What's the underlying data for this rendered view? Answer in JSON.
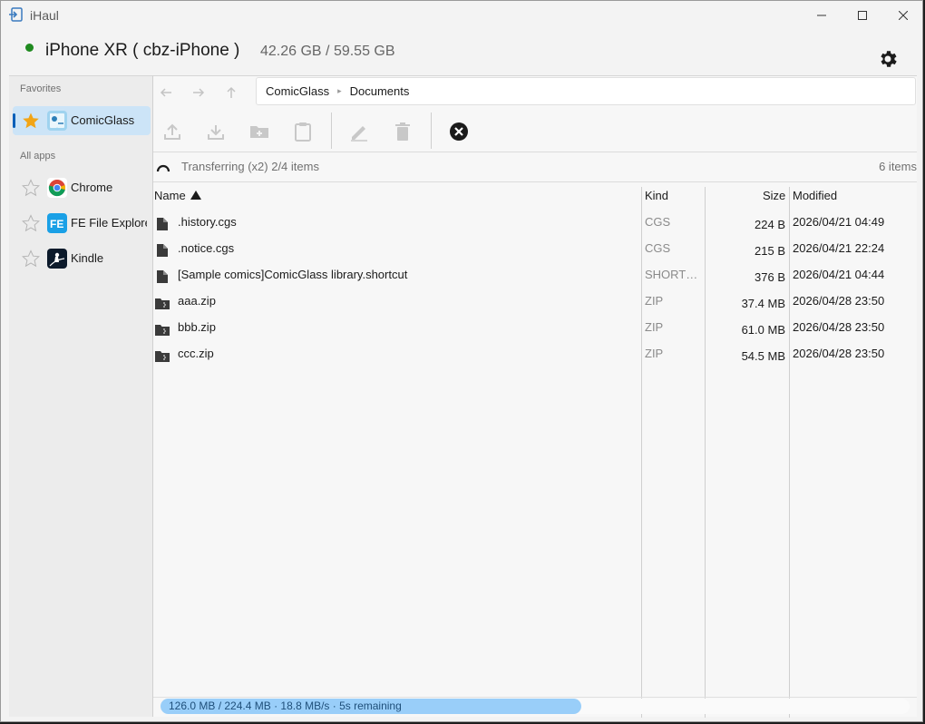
{
  "window": {
    "title": "iHaul"
  },
  "device": {
    "name": "iPhone XR ( cbz-iPhone )",
    "capacity": "42.26 GB / 59.55 GB",
    "status_color": "#1f8a1f"
  },
  "sidebar": {
    "favorites_header": "Favorites",
    "favorites": [
      {
        "label": "ComicGlass",
        "icon": "comicglass-app-icon",
        "starred": true,
        "selected": true
      }
    ],
    "all_apps_header": "All apps",
    "apps": [
      {
        "label": "Chrome",
        "icon": "chrome-app-icon",
        "starred": false
      },
      {
        "label": "FE File Explorer",
        "icon": "fe-file-explorer-app-icon",
        "starred": false
      },
      {
        "label": "Kindle",
        "icon": "kindle-app-icon",
        "starred": false
      }
    ]
  },
  "breadcrumb": [
    "ComicGlass",
    "Documents"
  ],
  "toolbar": {
    "buttons": [
      "upload-icon",
      "download-icon",
      "new-folder-icon",
      "paste-icon",
      "rename-icon",
      "delete-icon",
      "cancel-transfer-icon"
    ]
  },
  "status": {
    "text": "Transferring (x2) 2/4 items",
    "count": "6 items"
  },
  "table": {
    "headers": {
      "name": "Name",
      "kind": "Kind",
      "size": "Size",
      "modified": "Modified"
    },
    "rows": [
      {
        "name": ".history.cgs",
        "kind": "CGS",
        "size": "224 B",
        "modified": "2026/04/21 04:49",
        "icon": "file-icon"
      },
      {
        "name": ".notice.cgs",
        "kind": "CGS",
        "size": "215 B",
        "modified": "2026/04/21 22:24",
        "icon": "file-icon"
      },
      {
        "name": "[Sample comics]ComicGlass library.shortcut",
        "kind": "SHORTCUT",
        "size": "376 B",
        "modified": "2026/04/21 04:44",
        "icon": "file-icon"
      },
      {
        "name": "aaa.zip",
        "kind": "ZIP",
        "size": "37.4 MB",
        "modified": "2026/04/28 23:50",
        "icon": "zip-icon"
      },
      {
        "name": "bbb.zip",
        "kind": "ZIP",
        "size": "61.0 MB",
        "modified": "2026/04/28 23:50",
        "icon": "zip-icon"
      },
      {
        "name": "ccc.zip",
        "kind": "ZIP",
        "size": "54.5 MB",
        "modified": "2026/04/28 23:50",
        "icon": "zip-icon"
      }
    ]
  },
  "progress": {
    "text": "126.0 MB / 224.4 MB · 18.8 MB/s · 5s remaining",
    "fraction": 0.5615,
    "color": "#99cef9"
  }
}
